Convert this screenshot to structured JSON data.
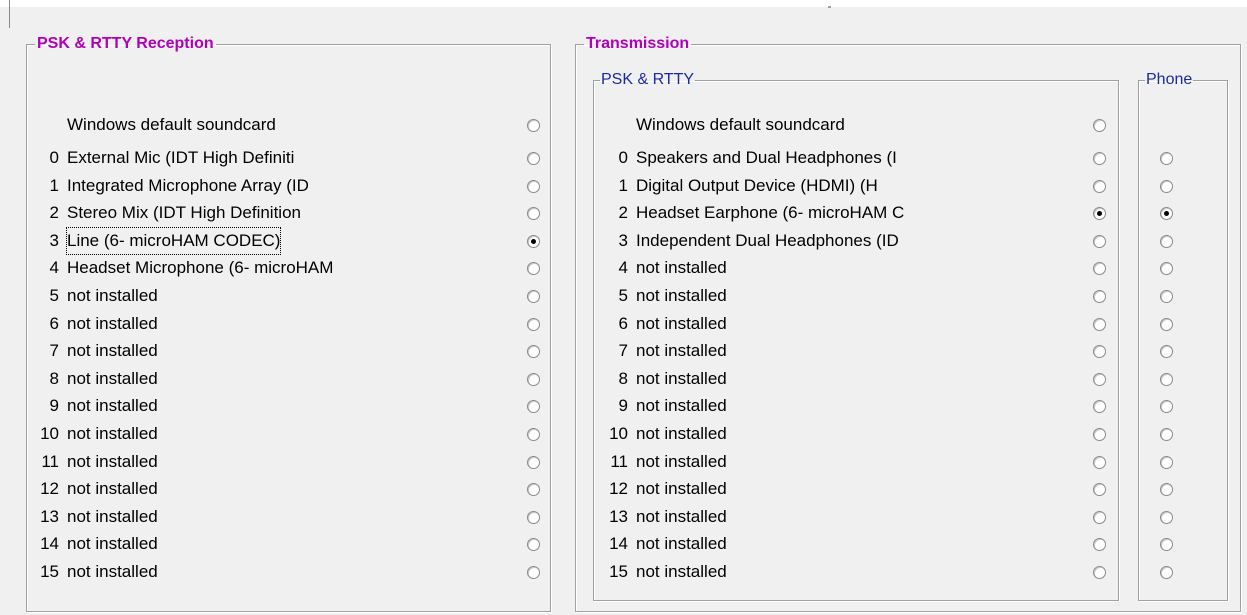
{
  "reception": {
    "title": "PSK & RTTY Reception",
    "default_label": "Windows default soundcard",
    "devices": [
      {
        "index": "0",
        "label": "External Mic (IDT High Definiti",
        "selected": false
      },
      {
        "index": "1",
        "label": "Integrated Microphone Array (ID",
        "selected": false
      },
      {
        "index": "2",
        "label": "Stereo Mix (IDT High Definition",
        "selected": false
      },
      {
        "index": "3",
        "label": "Line (6- microHAM CODEC)",
        "selected": true
      },
      {
        "index": "4",
        "label": "Headset Microphone (6- microHAM",
        "selected": false
      },
      {
        "index": "5",
        "label": "not installed",
        "selected": false
      },
      {
        "index": "6",
        "label": "not installed",
        "selected": false
      },
      {
        "index": "7",
        "label": "not installed",
        "selected": false
      },
      {
        "index": "8",
        "label": "not installed",
        "selected": false
      },
      {
        "index": "9",
        "label": "not installed",
        "selected": false
      },
      {
        "index": "10",
        "label": "not installed",
        "selected": false
      },
      {
        "index": "11",
        "label": "not installed",
        "selected": false
      },
      {
        "index": "12",
        "label": "not installed",
        "selected": false
      },
      {
        "index": "13",
        "label": "not installed",
        "selected": false
      },
      {
        "index": "14",
        "label": "not installed",
        "selected": false
      },
      {
        "index": "15",
        "label": "not installed",
        "selected": false
      }
    ]
  },
  "transmission": {
    "title": "Transmission",
    "psk_rtty": {
      "title": "PSK & RTTY",
      "default_label": "Windows default soundcard",
      "devices": [
        {
          "index": "0",
          "label": "Speakers and Dual Headphones (I",
          "selected": false
        },
        {
          "index": "1",
          "label": "Digital Output Device (HDMI) (H",
          "selected": false
        },
        {
          "index": "2",
          "label": "Headset Earphone (6- microHAM C",
          "selected": true
        },
        {
          "index": "3",
          "label": "Independent Dual Headphones (ID",
          "selected": false
        },
        {
          "index": "4",
          "label": "not installed",
          "selected": false
        },
        {
          "index": "5",
          "label": "not installed",
          "selected": false
        },
        {
          "index": "6",
          "label": "not installed",
          "selected": false
        },
        {
          "index": "7",
          "label": "not installed",
          "selected": false
        },
        {
          "index": "8",
          "label": "not installed",
          "selected": false
        },
        {
          "index": "9",
          "label": "not installed",
          "selected": false
        },
        {
          "index": "10",
          "label": "not installed",
          "selected": false
        },
        {
          "index": "11",
          "label": "not installed",
          "selected": false
        },
        {
          "index": "12",
          "label": "not installed",
          "selected": false
        },
        {
          "index": "13",
          "label": "not installed",
          "selected": false
        },
        {
          "index": "14",
          "label": "not installed",
          "selected": false
        },
        {
          "index": "15",
          "label": "not installed",
          "selected": false
        }
      ]
    },
    "phone": {
      "title": "Phone",
      "selected_index": "2"
    }
  }
}
